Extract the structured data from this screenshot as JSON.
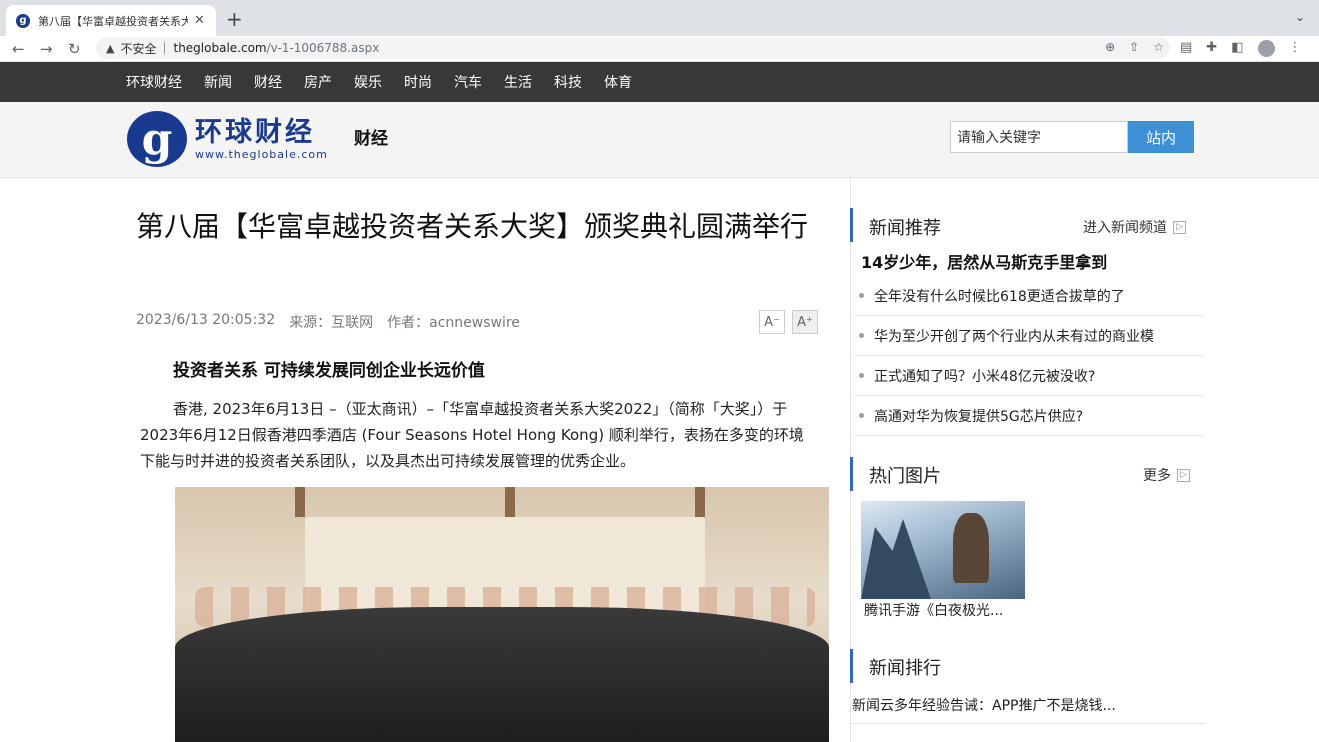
{
  "browser": {
    "tab_title": "第八届【华富卓越投资者关系大奖",
    "favicon_letter": "g",
    "insecure_label": "不安全",
    "url_host": "theglobale.com",
    "url_path": "/v-1-1006788.aspx"
  },
  "sitenav": {
    "items": [
      "环球财经",
      "新闻",
      "财经",
      "房产",
      "娱乐",
      "时尚",
      "汽车",
      "生活",
      "科技",
      "体育"
    ]
  },
  "header": {
    "logo_cn": "环球财经",
    "logo_url": "www.theglobale.com",
    "channel": "财经",
    "search_value": "请输入关键字",
    "search_button": "站内"
  },
  "article": {
    "title": "第八届【华富卓越投资者关系大奖】颁奖典礼圆满举行",
    "datetime": "2023/6/13 20:05:32",
    "source": "来源：互联网",
    "author": "作者：acnnewswire",
    "font_smaller": "A⁻",
    "font_larger": "A⁺",
    "subhead": "投资者关系 可持续发展同创企业长远价值",
    "paragraph": "香港, 2023年6月13日 –（亚太商讯）–「华富卓越投资者关系大奖2022」（简称「大奖」）于2023年6月12日假香港四季酒店 (Four Seasons Hotel Hong Kong) 顺利举行，表扬在多变的环境下能与时并进的投资者关系团队，以及具杰出可持续发展管理的优秀企业。"
  },
  "sidebar": {
    "news_recommend": {
      "title": "新闻推荐",
      "more": "进入新闻频道",
      "headline": "14岁少年，居然从马斯克手里拿到",
      "items": [
        "全年没有什么时候比618更适合拔草的了",
        "华为至少开创了两个行业内从未有过的商业模",
        "正式通知了吗？小米48亿元被没收?",
        "高通对华为恢复提供5G芯片供应?"
      ]
    },
    "hot_pictures": {
      "title": "热门图片",
      "more": "更多",
      "caption": "腾讯手游《白夜极光..."
    },
    "news_ranking": {
      "title": "新闻排行",
      "items": [
        "新闻云多年经验告诫：APP推广不是烧钱..."
      ]
    }
  }
}
